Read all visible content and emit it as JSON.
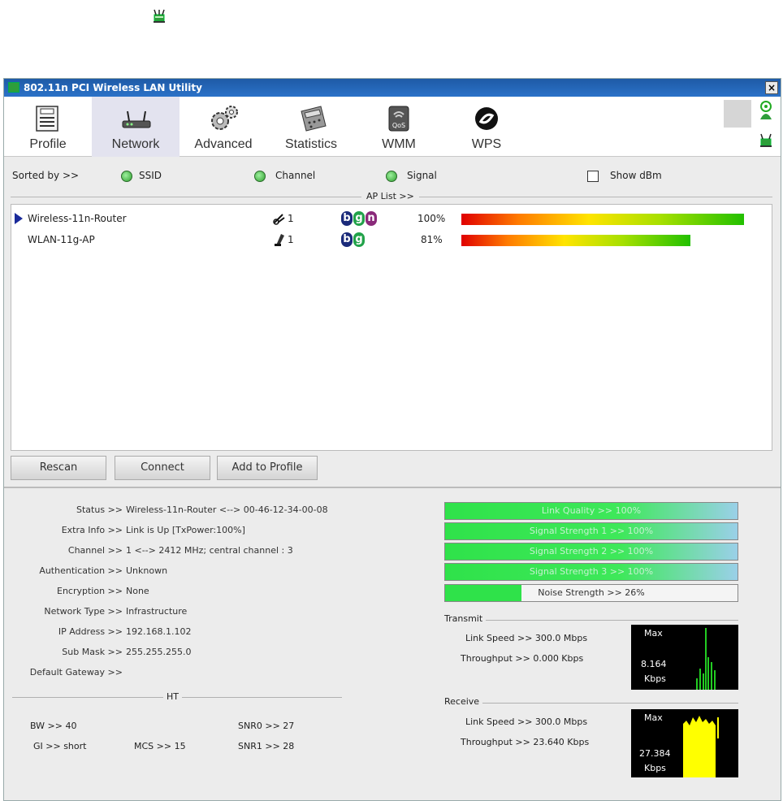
{
  "window": {
    "title": "802.11n PCI Wireless LAN Utility",
    "close_label": "×"
  },
  "tabs": [
    {
      "label": "Profile",
      "icon": "profile-icon"
    },
    {
      "label": "Network",
      "icon": "router-icon"
    },
    {
      "label": "Advanced",
      "icon": "gears-icon"
    },
    {
      "label": "Statistics",
      "icon": "calculator-icon"
    },
    {
      "label": "WMM",
      "icon": "wmm-qos-icon"
    },
    {
      "label": "WPS",
      "icon": "wps-icon"
    }
  ],
  "sort": {
    "prefix": "Sorted by >>",
    "options": [
      "SSID",
      "Channel",
      "Signal"
    ],
    "show_dbm": "Show dBm"
  },
  "ap_list": {
    "header": "AP List >>",
    "rows": [
      {
        "ssid": "Wireless-11n-Router",
        "channel": "1",
        "modes": [
          "b",
          "g",
          "n"
        ],
        "signal": "100%",
        "signal_value": 100,
        "selected": true
      },
      {
        "ssid": "WLAN-11g-AP",
        "channel": "1",
        "modes": [
          "b",
          "g"
        ],
        "signal": "81%",
        "signal_value": 81,
        "selected": false
      }
    ]
  },
  "buttons": {
    "rescan": "Rescan",
    "connect": "Connect",
    "add_profile": "Add to Profile"
  },
  "info": [
    {
      "label": "Status >>",
      "value": "Wireless-11n-Router <--> 00-46-12-34-00-08"
    },
    {
      "label": "Extra Info >>",
      "value": "Link is Up [TxPower:100%]"
    },
    {
      "label": "Channel >>",
      "value": "1 <--> 2412 MHz; central channel : 3"
    },
    {
      "label": "Authentication >>",
      "value": "Unknown"
    },
    {
      "label": "Encryption >>",
      "value": "None"
    },
    {
      "label": "Network Type >>",
      "value": "Infrastructure"
    },
    {
      "label": "IP Address >>",
      "value": "192.168.1.102"
    },
    {
      "label": "Sub Mask >>",
      "value": "255.255.255.0"
    },
    {
      "label": "Default Gateway >>",
      "value": ""
    }
  ],
  "ht": {
    "title": "HT",
    "bw": "BW >> 40",
    "gi": "GI >> short",
    "mcs": "MCS >> 15",
    "snr0": "SNR0 >> 27",
    "snr1": "SNR1 >> 28"
  },
  "quality": [
    {
      "label": "Link Quality >> 100%",
      "value": 100
    },
    {
      "label": "Signal Strength 1 >> 100%",
      "value": 100
    },
    {
      "label": "Signal Strength 2 >> 100%",
      "value": 100
    },
    {
      "label": "Signal Strength 3 >> 100%",
      "value": 100
    },
    {
      "label": "Noise Strength >> 26%",
      "value": 26
    }
  ],
  "transmit": {
    "title": "Transmit",
    "link_speed": "Link Speed >> 300.0 Mbps",
    "throughput": "Throughput >> 0.000 Kbps",
    "graph_max": "Max",
    "graph_value": "8.164",
    "graph_unit": "Kbps"
  },
  "receive": {
    "title": "Receive",
    "link_speed": "Link Speed >> 300.0 Mbps",
    "throughput": "Throughput >> 23.640 Kbps",
    "graph_max": "Max",
    "graph_value": "27.384",
    "graph_unit": "Kbps"
  },
  "colors": {
    "title_bar": "#1e5aa6",
    "quality_green": "#2fe24a",
    "rx_graph": "#ffff00",
    "tx_graph": "#22cc22"
  }
}
